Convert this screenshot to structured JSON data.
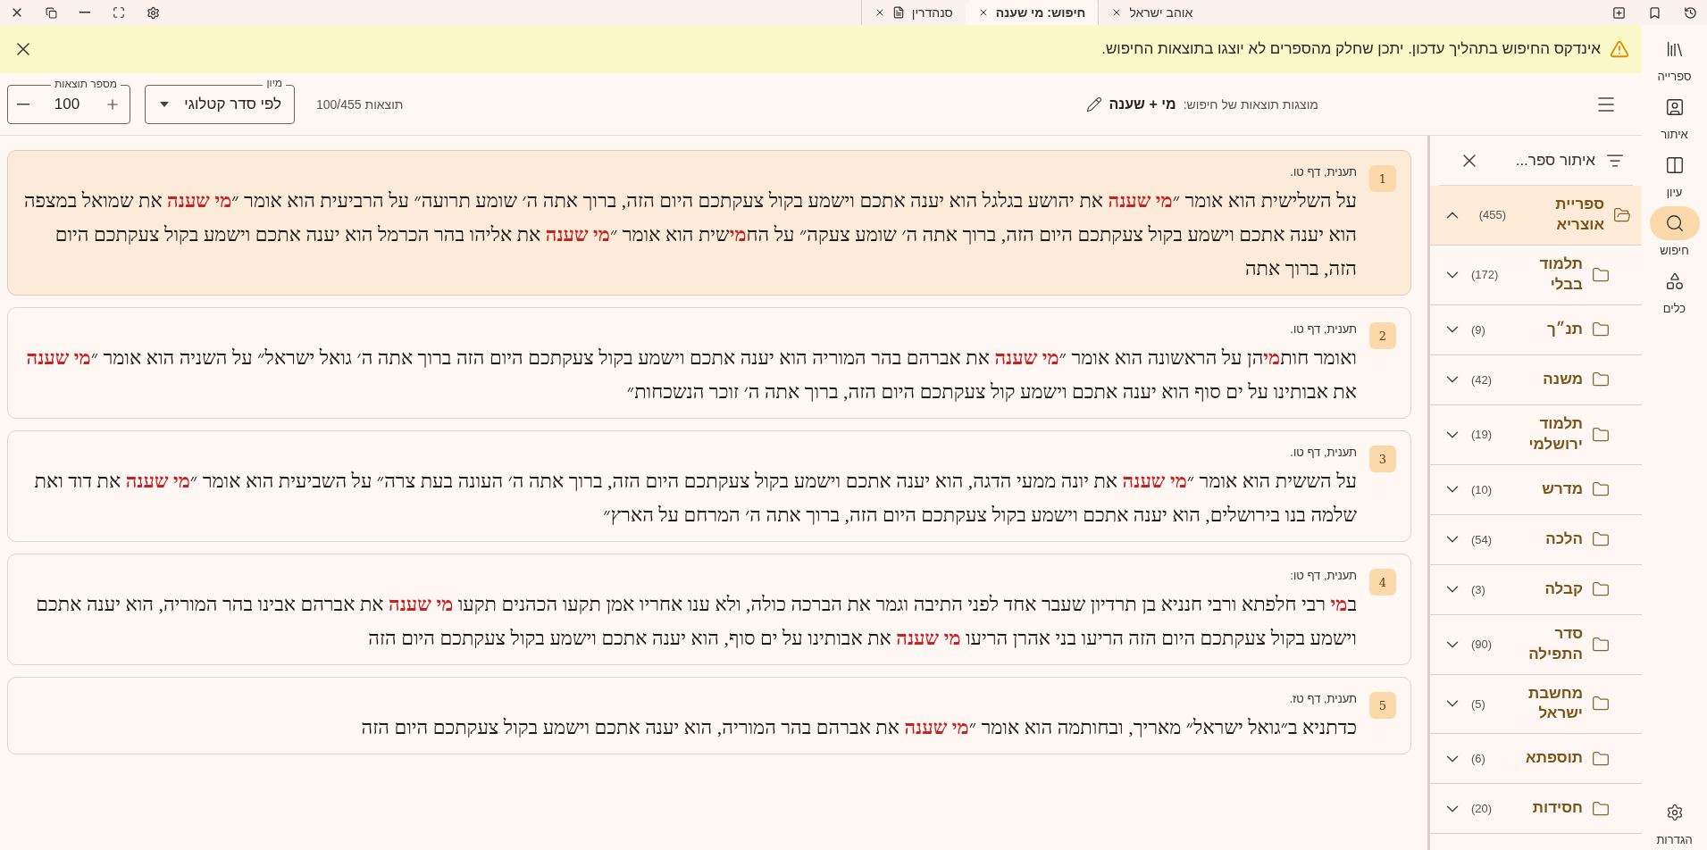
{
  "tabs": [
    {
      "label": "אוהב ישראל",
      "selected": false,
      "kind": "text"
    },
    {
      "label": "חיפוש: מי שענה",
      "selected": true,
      "kind": "text"
    },
    {
      "label": "סנהדרין",
      "selected": false,
      "kind": "pdf"
    }
  ],
  "banner": {
    "text": "אינדקס החיפוש בתהליך עדכון. יתכן שחלק מהספרים לא יוצגו בתוצאות החיפוש."
  },
  "toolbar": {
    "query_label": "מוצגות תוצאות של חיפוש:",
    "query": "מי + שענה",
    "count": "תוצאות 100/455",
    "sort": {
      "label": "מיון",
      "value": "לפי סדר קטלוגי"
    },
    "max_results": {
      "label": "מספר תוצאות",
      "value": "100"
    }
  },
  "results": [
    {
      "number": "1",
      "reference": "תענית, דף טו.",
      "selected": true,
      "text": "על השלישית הוא אומר ״**מי שענה** את יהושע בגלגל הוא יענה אתכם וישמע בקול צעקתכם היום הזה, ברוך אתה ה׳ שומע תרועה״ על הרביעית הוא אומר ״**מי שענה** את שמואל במצפה הוא יענה אתכם וישמע בקול צעקתכם היום הזה, ברוך אתה ה׳ שומע צעקה״ על הח**מי**שית הוא אומר ״**מי שענה** את אליהו בהר הכרמל הוא יענה אתכם וישמע בקול צעקתכם היום הזה, ברוך אתה"
    },
    {
      "number": "2",
      "reference": "תענית, דף טו.",
      "selected": false,
      "text": "ואומר חות**מי**הן על הראשונה הוא אומר ״**מי שענה** את אברהם בהר המוריה הוא יענה אתכם וישמע בקול צעקתכם היום הזה ברוך אתה ה׳ גואל ישראל״ על השניה הוא אומר ״**מי שענה** את אבותינו על ים סוף הוא יענה אתכם וישמע קול צעקתכם היום הזה, ברוך אתה ה׳ זוכר הנשכחות״"
    },
    {
      "number": "3",
      "reference": "תענית, דף טו.",
      "selected": false,
      "text": "על הששית הוא אומר ״**מי שענה** את יונה ממעי הדגה, הוא יענה אתכם וישמע בקול צעקתכם היום הזה, ברוך אתה ה׳ העונה בעת צרה״ על השביעית הוא אומר ״**מי שענה** את דוד ואת שלמה בנו בירושלים, הוא יענה אתכם וישמע בקול צעקתכם היום הזה, ברוך אתה ה׳ המרחם על הארץ״"
    },
    {
      "number": "4",
      "reference": "תענית, דף טו:",
      "selected": false,
      "text": "ב**מי** רבי חלפתא ורבי חנניא בן תרדיון שעבר אחד לפני התיבה וגמר את הברכה כולה, ולא ענו אחריו אמן תקעו הכהנים תקעו **מי שענה** את אברהם אבינו בהר המוריה, הוא יענה אתכם וישמע בקול צעקתכם היום הזה הריעו בני אהרן הריעו **מי שענה** את אבותינו על ים סוף, הוא יענה אתכם וישמע בקול צעקתכם היום הזה"
    },
    {
      "number": "5",
      "reference": "תענית, דף טז.",
      "selected": false,
      "text": "כדתניא ב״גואל ישראל״ מאריך, ובחותמה הוא אומר ״**מי שענה** את אברהם בהר המוריה, הוא יענה אתכם וישמע בקול צעקתכם היום הזה"
    }
  ],
  "book_filter": {
    "placeholder": "איתור ספר...",
    "tree": [
      {
        "name": "ספריית אוצריא",
        "count": "(455)",
        "expanded": true,
        "selected": true,
        "children": [
          {
            "name": "תלמוד בבלי",
            "count": "(172)",
            "expanded": false,
            "selected": false
          },
          {
            "name": "תנ״ך",
            "count": "(9)",
            "expanded": false,
            "selected": false
          },
          {
            "name": "משנה",
            "count": "(42)",
            "expanded": false,
            "selected": false
          },
          {
            "name": "תלמוד ירושלמי",
            "count": "(19)",
            "expanded": false,
            "selected": false
          },
          {
            "name": "מדרש",
            "count": "(10)",
            "expanded": false,
            "selected": false
          },
          {
            "name": "הלכה",
            "count": "(54)",
            "expanded": false,
            "selected": false
          },
          {
            "name": "קבלה",
            "count": "(3)",
            "expanded": false,
            "selected": false
          },
          {
            "name": "סדר התפילה",
            "count": "(90)",
            "expanded": false,
            "selected": false
          },
          {
            "name": "מחשבת ישראל",
            "count": "(5)",
            "expanded": false,
            "selected": false
          },
          {
            "name": "תוספתא",
            "count": "(6)",
            "expanded": false,
            "selected": false
          },
          {
            "name": "חסידות",
            "count": "(20)",
            "expanded": false,
            "selected": false
          }
        ]
      }
    ]
  },
  "nav": [
    {
      "label": "ספרייה",
      "kind": "library",
      "selected": false
    },
    {
      "label": "איתור",
      "kind": "find",
      "selected": false
    },
    {
      "label": "עיון",
      "kind": "study",
      "selected": false
    },
    {
      "label": "חיפוש",
      "kind": "search",
      "selected": true
    },
    {
      "label": "כלים",
      "kind": "tools",
      "selected": false
    }
  ],
  "settings": {
    "label": "הגדרות"
  }
}
